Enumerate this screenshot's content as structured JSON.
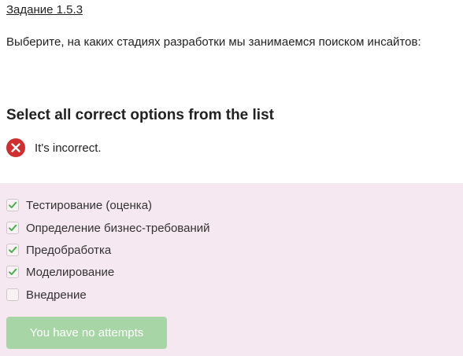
{
  "task": {
    "link_text": "Задание 1.5.3",
    "question": "Выберите, на каких стадиях разработки мы занимаемся поиском инсайтов:"
  },
  "quiz": {
    "section_title": "Select all correct options from the list",
    "feedback": {
      "text": "It's incorrect.",
      "icon": "error-x-circle-icon",
      "color": "#d12f2f"
    },
    "options": [
      {
        "label": "Тестирование (оценка)",
        "checked": true
      },
      {
        "label": "Определение бизнес-требований",
        "checked": true
      },
      {
        "label": "Предобработка",
        "checked": true
      },
      {
        "label": "Моделирование",
        "checked": true
      },
      {
        "label": "Внедрение",
        "checked": false
      }
    ],
    "submit_button": {
      "label": "You have no attempts",
      "disabled": true
    }
  },
  "colors": {
    "panel_background": "#f5e8f0",
    "check_green": "#4caf50",
    "button_disabled": "#a7d5a6",
    "error_red": "#d12f2f"
  }
}
